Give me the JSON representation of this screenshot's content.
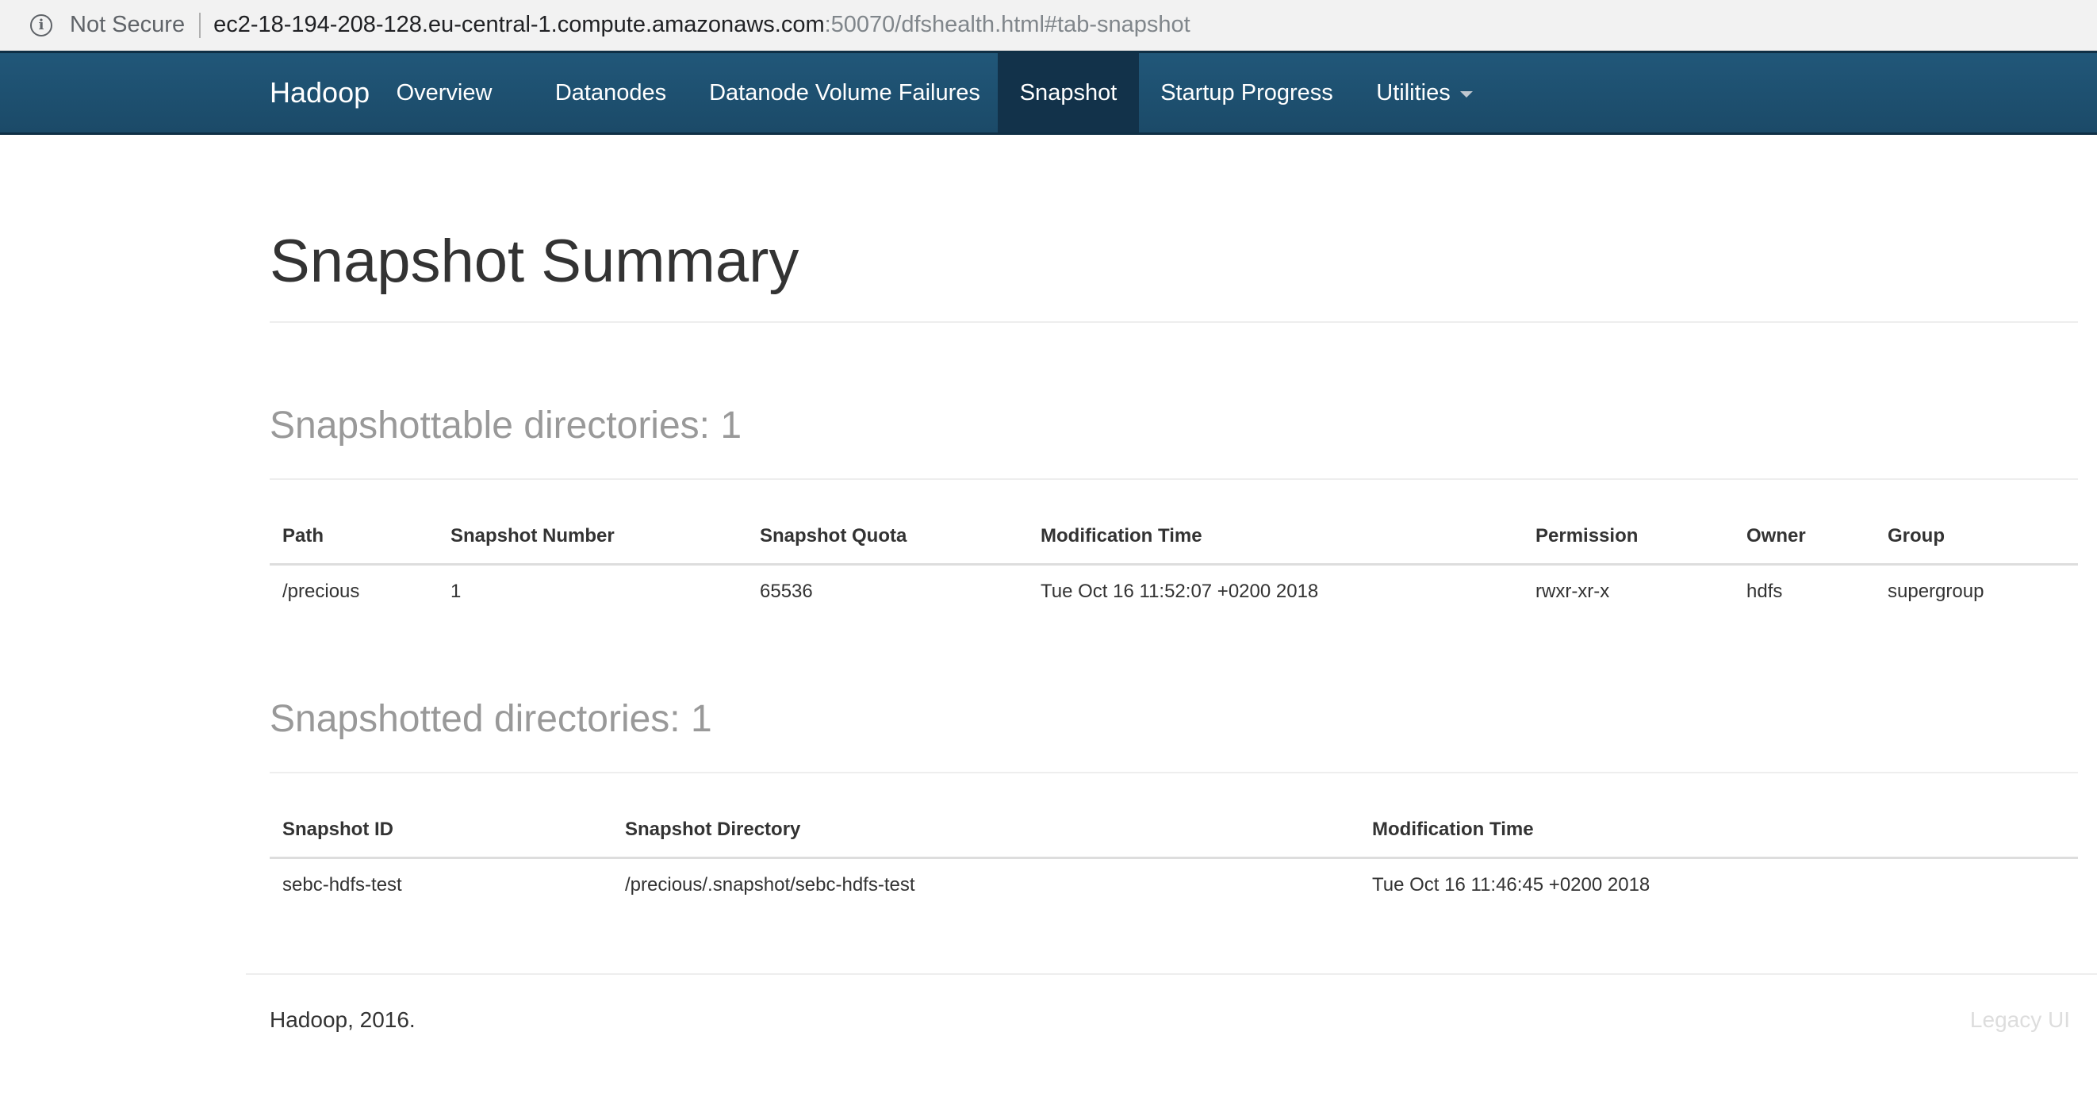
{
  "browser": {
    "security_label": "Not Secure",
    "url_host": "ec2-18-194-208-128.eu-central-1.compute.amazonaws.com",
    "url_rest": ":50070/dfshealth.html#tab-snapshot"
  },
  "navbar": {
    "brand": "Hadoop",
    "items": [
      {
        "label": "Overview"
      },
      {
        "label": "Datanodes"
      },
      {
        "label": "Datanode Volume Failures"
      },
      {
        "label": "Snapshot"
      },
      {
        "label": "Startup Progress"
      },
      {
        "label": "Utilities"
      }
    ],
    "active_item": "Snapshot"
  },
  "page": {
    "title": "Snapshot Summary"
  },
  "snapshottable": {
    "title": "Snapshottable directories: 1",
    "columns": [
      "Path",
      "Snapshot Number",
      "Snapshot Quota",
      "Modification Time",
      "Permission",
      "Owner",
      "Group"
    ],
    "rows": [
      [
        "/precious",
        "1",
        "65536",
        "Tue Oct 16 11:52:07 +0200 2018",
        "rwxr-xr-x",
        "hdfs",
        "supergroup"
      ]
    ]
  },
  "snapshotted": {
    "title": "Snapshotted directories: 1",
    "columns": [
      "Snapshot ID",
      "Snapshot Directory",
      "Modification Time"
    ],
    "rows": [
      [
        "sebc-hdfs-test",
        "/precious/.snapshot/sebc-hdfs-test",
        "Tue Oct 16 11:46:45 +0200 2018"
      ]
    ]
  },
  "footer": {
    "copyright": "Hadoop, 2016.",
    "legacy_link": "Legacy UI"
  },
  "colors": {
    "navbar_bg": "#1f4e6e",
    "navbar_active": "#12324a",
    "section_title": "#999999"
  }
}
